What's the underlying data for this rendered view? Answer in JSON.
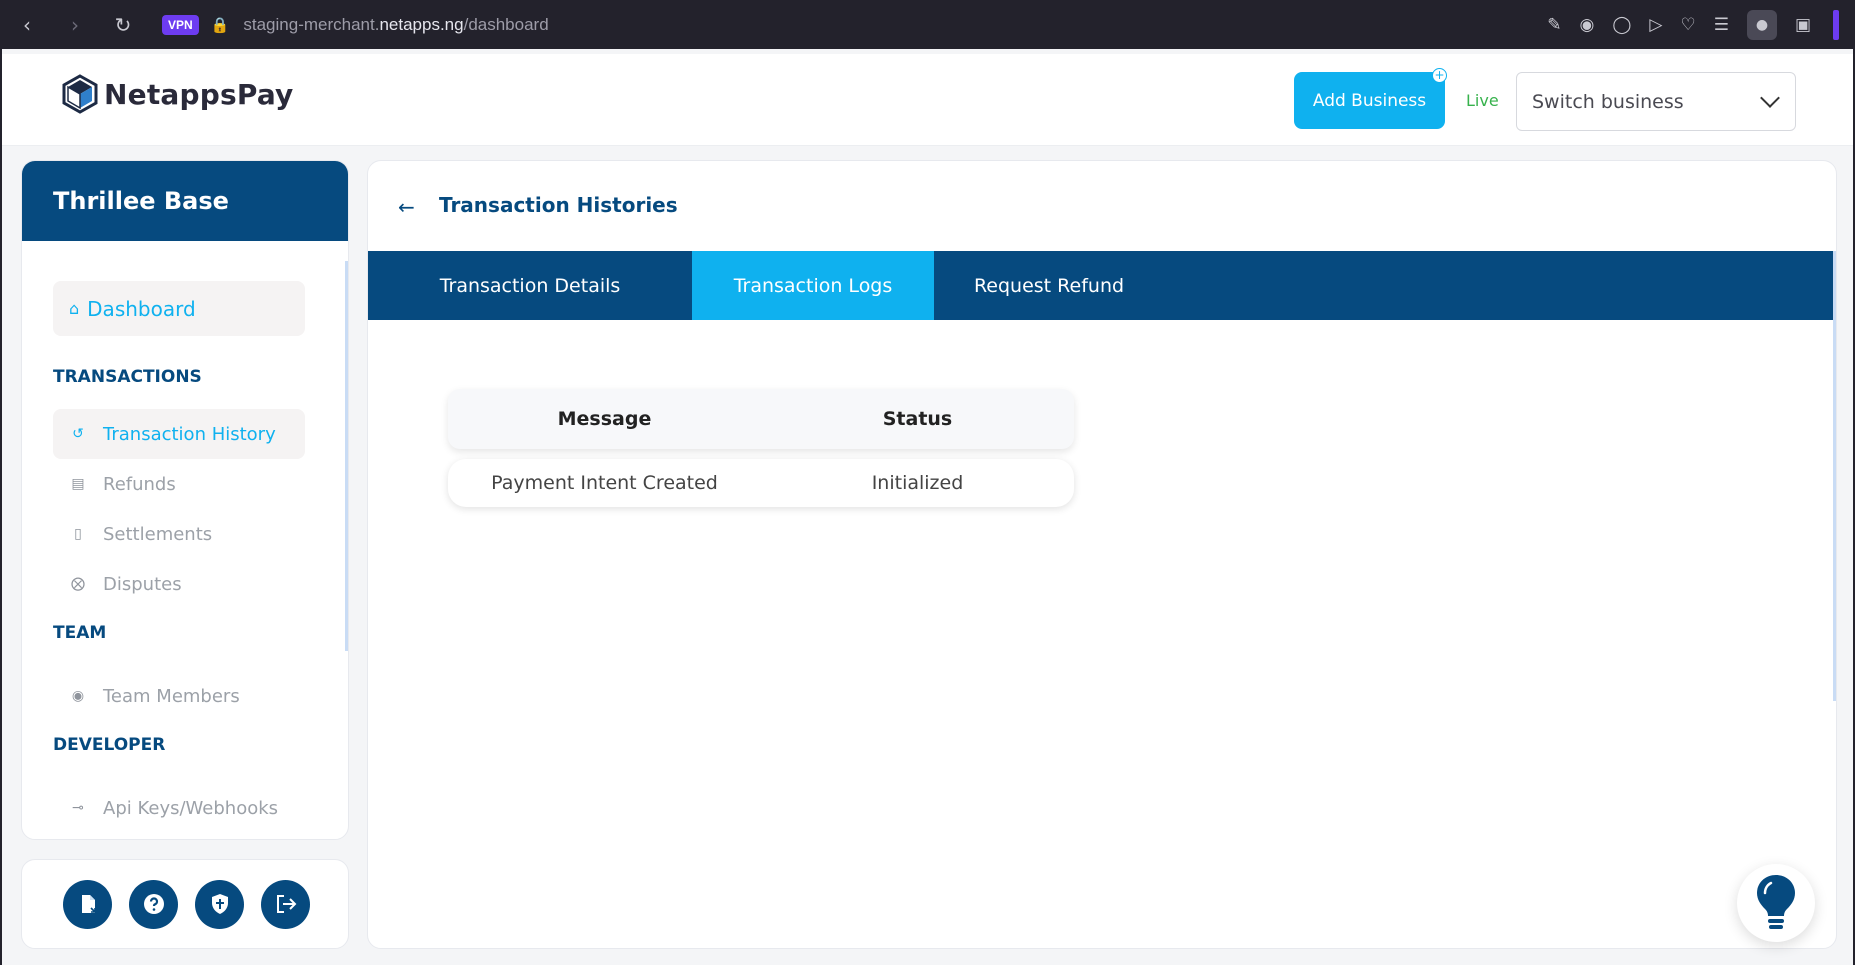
{
  "browser": {
    "vpn_label": "VPN",
    "url_prefix": "staging-merchant.",
    "url_host": "netapps.ng",
    "url_path": "/dashboard"
  },
  "header": {
    "logo_text": "NetappsPay",
    "add_business_label": "Add Business",
    "mode_label": "Live",
    "switch_business_placeholder": "Switch business"
  },
  "sidebar": {
    "business_name": "Thrillee Base",
    "dashboard_label": "Dashboard",
    "sections": {
      "transactions": "TRANSACTIONS",
      "team": "TEAM",
      "developer": "DEVELOPER"
    },
    "items": {
      "transaction_history": "Transaction History",
      "refunds": "Refunds",
      "settlements": "Settlements",
      "disputes": "Disputes",
      "team_members": "Team Members",
      "api_keys": "Api Keys/Webhooks"
    },
    "active_item": "Transaction History"
  },
  "main": {
    "title": "Transaction Histories",
    "tabs": [
      "Transaction Details",
      "Transaction Logs",
      "Request Refund"
    ],
    "active_tab": "Transaction Logs",
    "logs": {
      "columns": [
        "Message",
        "Status"
      ],
      "rows": [
        [
          "Payment Intent Created",
          "Initialized"
        ]
      ]
    }
  },
  "colors": {
    "brand_navy": "#064a7f",
    "accent_cyan": "#0fb1ef",
    "live_green": "#37b24d"
  }
}
